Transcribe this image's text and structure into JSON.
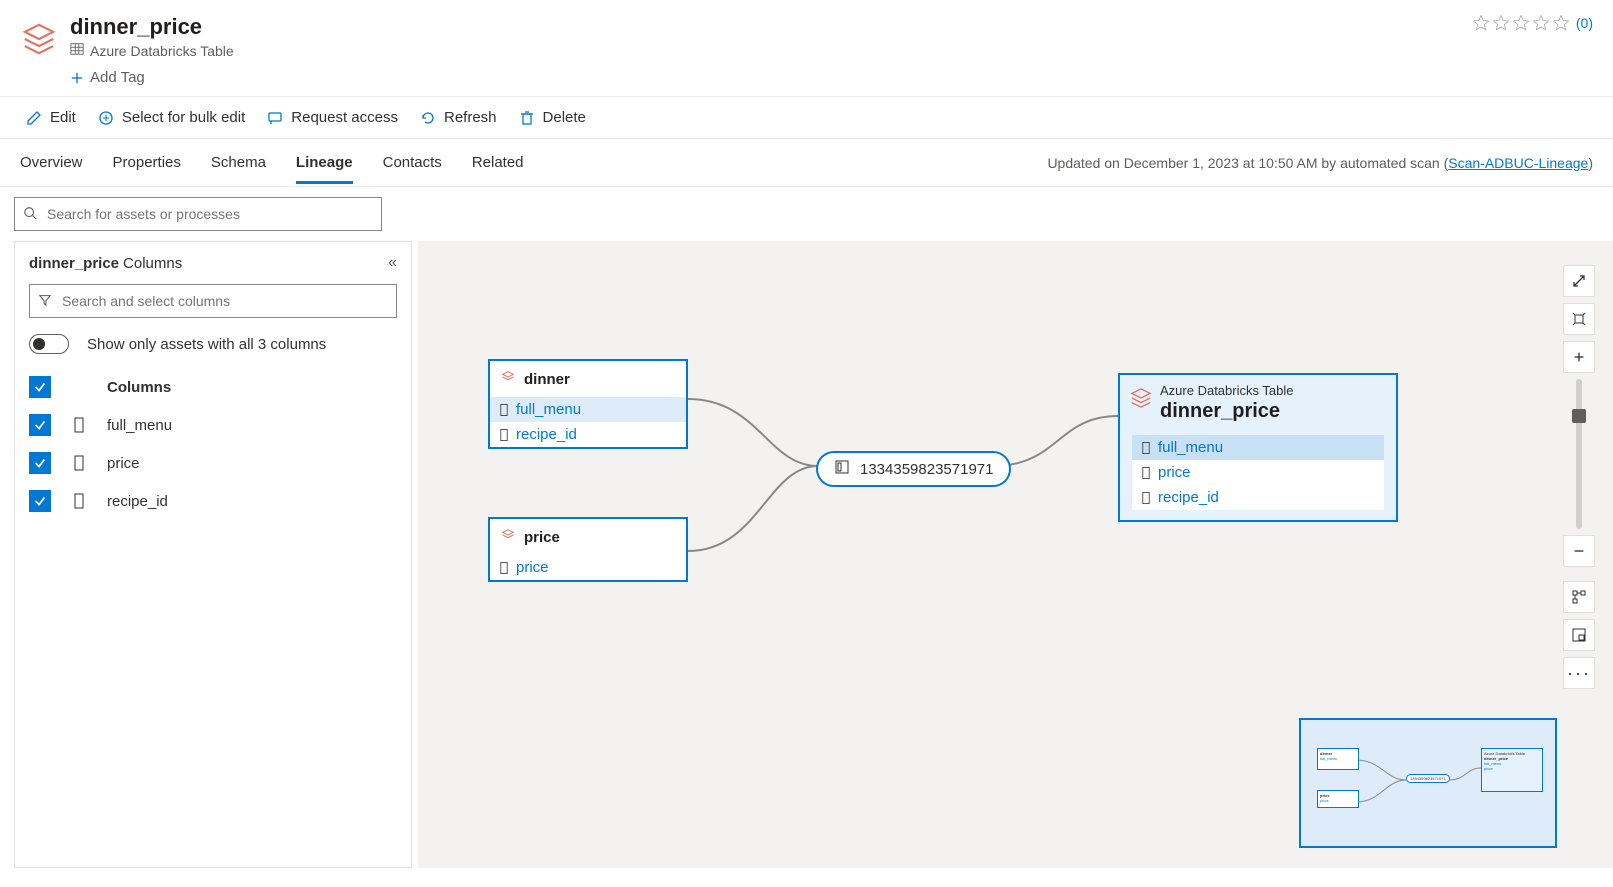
{
  "header": {
    "title": "dinner_price",
    "subtype": "Azure Databricks Table",
    "add_tag": "Add Tag",
    "rating_count": "(0)"
  },
  "toolbar": {
    "edit": "Edit",
    "bulk": "Select for bulk edit",
    "request": "Request access",
    "refresh": "Refresh",
    "delete": "Delete"
  },
  "tabs": {
    "overview": "Overview",
    "properties": "Properties",
    "schema": "Schema",
    "lineage": "Lineage",
    "contacts": "Contacts",
    "related": "Related"
  },
  "updated": {
    "prefix": "Updated on December 1, 2023 at 10:50 AM by automated scan (",
    "link": "Scan-ADBUC-Lineage",
    "suffix": ")"
  },
  "search": {
    "placeholder": "Search for assets or processes"
  },
  "sidebar": {
    "title_bold": "dinner_price",
    "title_rest": "Columns",
    "filter_placeholder": "Search and select columns",
    "toggle_label": "Show only assets with all 3 columns",
    "columns_header": "Columns",
    "cols": [
      "full_menu",
      "price",
      "recipe_id"
    ]
  },
  "lineage": {
    "dinner": {
      "name": "dinner",
      "fields": [
        "full_menu",
        "recipe_id"
      ]
    },
    "price": {
      "name": "price",
      "fields": [
        "price"
      ]
    },
    "process": "1334359823571971",
    "target": {
      "subtype": "Azure Databricks Table",
      "name": "dinner_price",
      "fields": [
        "full_menu",
        "price",
        "recipe_id"
      ]
    }
  }
}
